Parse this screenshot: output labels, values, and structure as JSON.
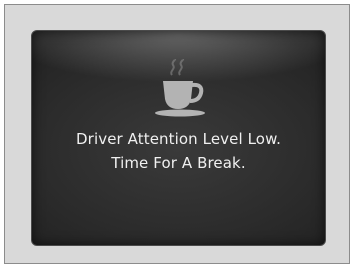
{
  "display": {
    "icon": "coffee-cup-icon",
    "message": {
      "line1": "Driver Attention Level Low.",
      "line2": "Time For A Break."
    }
  },
  "colors": {
    "screen_background": "#2b2b2b",
    "icon": "#b3b3b3",
    "text": "#f0f0f0",
    "frame": "#d9d9d9"
  }
}
